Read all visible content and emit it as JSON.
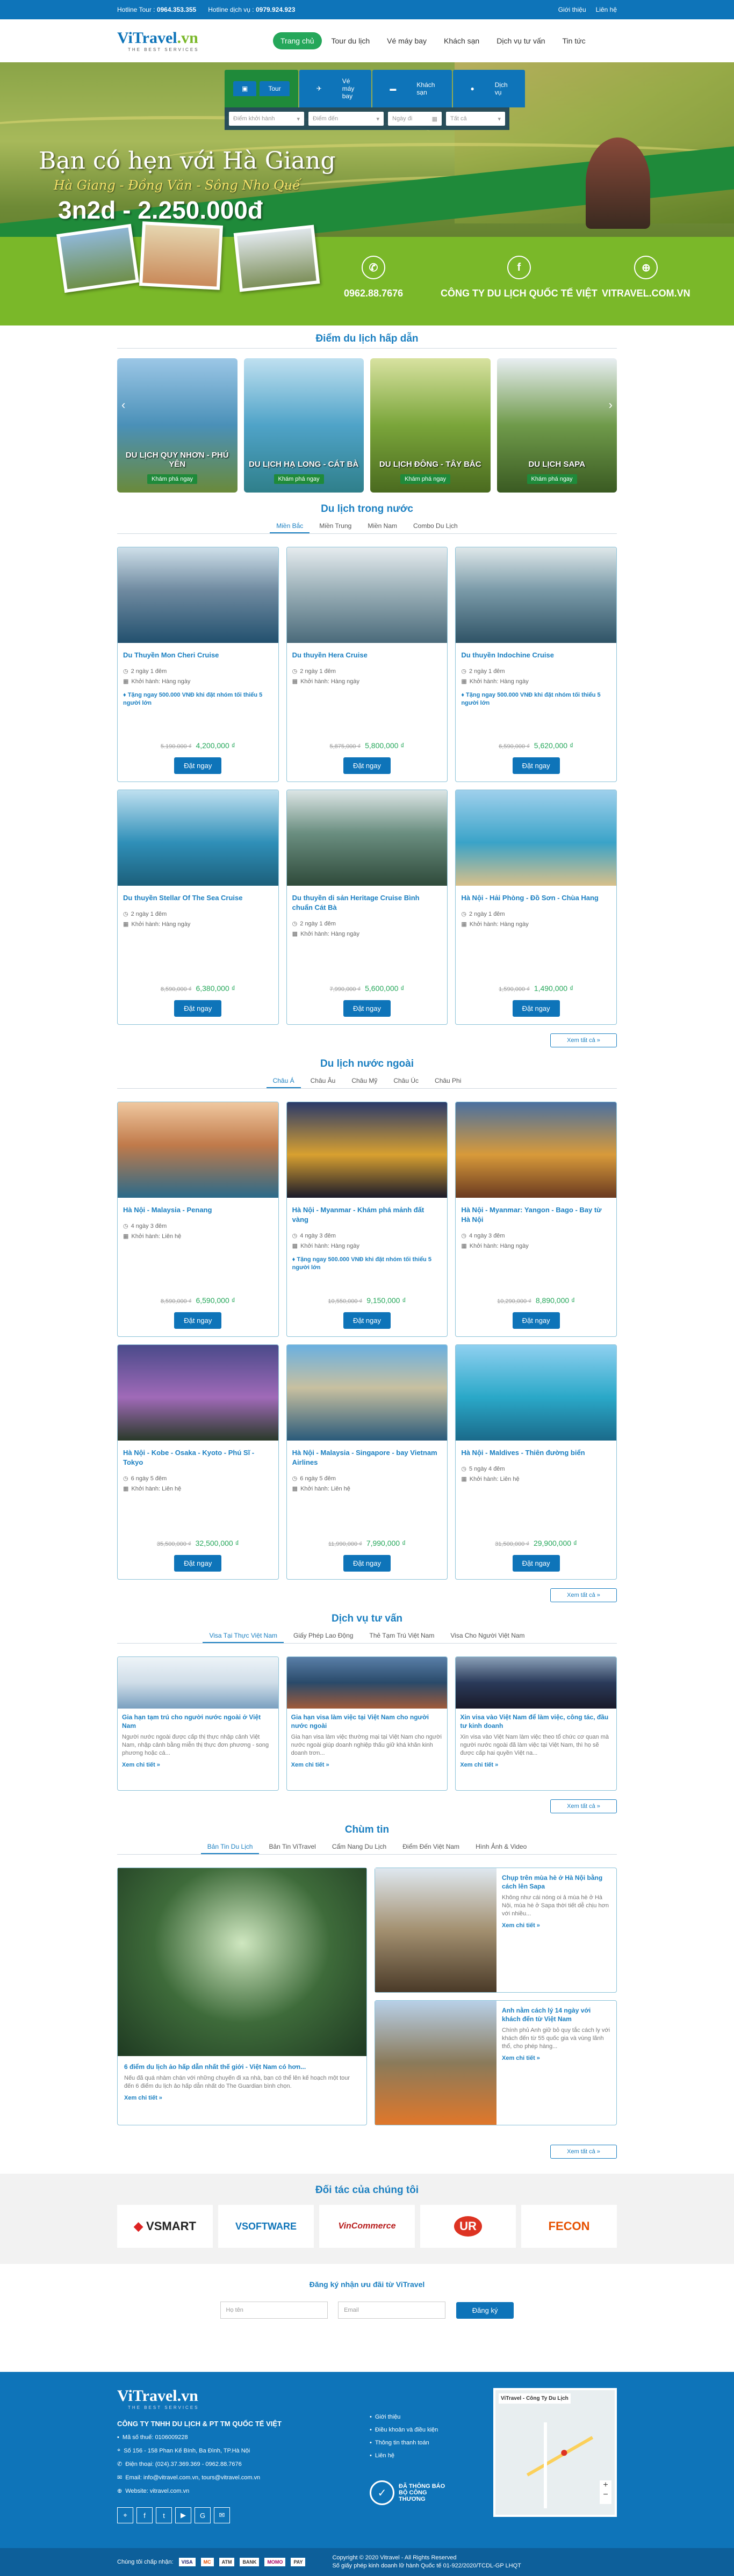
{
  "topbar": {
    "tour_label": "Hotline Tour :",
    "tour_phone": "0964.353.355",
    "service_label": "Hotline dịch vụ :",
    "service_phone": "0979.924.923",
    "links": [
      "Giới thiệu",
      "Liên hệ"
    ]
  },
  "header": {
    "logo_main": "ViTravel",
    "logo_suffix": ".vn",
    "logo_slogan": "THE BEST SERVICES",
    "nav": [
      "Trang chủ",
      "Tour du lịch",
      "Vé máy bay",
      "Khách sạn",
      "Dịch vụ tư vấn",
      "Tin tức"
    ]
  },
  "search": {
    "tabs": [
      "Tour",
      "Vé máy bay",
      "Khách sạn",
      "Dịch vụ"
    ],
    "from_placeholder": "Điểm khởi hành",
    "to_placeholder": "Điểm đến",
    "date_placeholder": "Ngày đi",
    "all_label": "Tất cả"
  },
  "hero": {
    "title": "Bạn có hẹn với Hà Giang",
    "subtitle": "Hà Giang - Đồng Văn - Sông Nho Quế",
    "price": "3n2d - 2.250.000đ",
    "phone": "0962.88.7676",
    "company": "CÔNG TY DU LỊCH QUỐC TẾ VIỆT",
    "site": "VITRAVEL.COM.VN"
  },
  "destinations": {
    "title": "Điểm du lịch hấp dẫn",
    "explore": "Khám phá ngay",
    "items": [
      "DU LỊCH QUY NHƠN - PHÚ YÊN",
      "DU LỊCH HẠ LONG - CÁT BÀ",
      "DU LỊCH ĐÔNG - TÂY BẮC",
      "DU LỊCH SAPA"
    ]
  },
  "domestic": {
    "title": "Du lịch trong nước",
    "tabs": [
      "Miền Bắc",
      "Miền Trung",
      "Miền Nam",
      "Combo Du Lịch"
    ],
    "more": "Xem tất cả »",
    "book": "Đặt ngay",
    "depart": "Khởi hành: Hàng ngày",
    "items": [
      {
        "title": "Du Thuyền Mon Cheri Cruise",
        "days": "2 ngày 1 đêm",
        "promo": "Tặng ngay 500.000 VNĐ khi đặt nhóm tối thiểu 5 người lớn",
        "old": "5.190.000 ₫",
        "price": "4,200,000 ₫"
      },
      {
        "title": "Du thuyền Hera Cruise",
        "days": "2 ngày 1 đêm",
        "promo": "",
        "old": "5,875,000 ₫",
        "price": "5,800,000 ₫"
      },
      {
        "title": "Du thuyền Indochine Cruise",
        "days": "2 ngày 1 đêm",
        "promo": "Tặng ngay 500.000 VNĐ khi đặt nhóm tối thiểu 5 người lớn",
        "old": "6,590,000 ₫",
        "price": "5,620,000 ₫"
      },
      {
        "title": "Du thuyền Stellar Of The Sea Cruise",
        "days": "2 ngày 1 đêm",
        "promo": "",
        "old": "8,590,000 ₫",
        "price": "6,380,000 ₫"
      },
      {
        "title": "Du thuyền di sản Heritage Cruise Bình chuẩn Cát Bà",
        "days": "2 ngày 1 đêm",
        "promo": "",
        "old": "7,990,000 ₫",
        "price": "5,600,000 ₫"
      },
      {
        "title": "Hà Nội - Hải Phòng - Đồ Sơn - Chùa Hang",
        "days": "2 ngày 1 đêm",
        "promo": "",
        "old": "1,590,000 ₫",
        "price": "1,490,000 ₫"
      }
    ]
  },
  "foreign": {
    "title": "Du lịch nước ngoài",
    "tabs": [
      "Châu Á",
      "Châu Âu",
      "Châu Mỹ",
      "Châu Úc",
      "Châu Phi"
    ],
    "more": "Xem tất cả »",
    "book": "Đặt ngay",
    "items": [
      {
        "title": "Hà Nội - Malaysia - Penang",
        "days": "4 ngày 3 đêm",
        "depart": "Khởi hành: Liên hệ",
        "promo": "",
        "old": "8,590,000 ₫",
        "price": "6,590,000 ₫"
      },
      {
        "title": "Hà Nội - Myanmar - Khám phá mảnh đất vàng",
        "days": "4 ngày 3 đêm",
        "depart": "Khởi hành: Hàng ngày",
        "promo": "Tặng ngay 500.000 VNĐ khi đặt nhóm tối thiểu 5 người lớn",
        "old": "10,550,000 ₫",
        "price": "9,150,000 ₫"
      },
      {
        "title": "Hà Nội - Myanmar: Yangon - Bago - Bay từ Hà Nội",
        "days": "4 ngày 3 đêm",
        "depart": "Khởi hành: Hàng ngày",
        "promo": "",
        "old": "10,290,000 ₫",
        "price": "8,890,000 ₫"
      },
      {
        "title": "Hà Nội - Kobe - Osaka - Kyoto - Phú Sĩ - Tokyo",
        "days": "6 ngày 5 đêm",
        "depart": "Khởi hành: Liên hệ",
        "promo": "",
        "old": "35,500,000 ₫",
        "price": "32,500,000 ₫"
      },
      {
        "title": "Hà Nội - Malaysia - Singapore - bay Vietnam Airlines",
        "days": "6 ngày 5 đêm",
        "depart": "Khởi hành: Liên hệ",
        "promo": "",
        "old": "11,990,000 ₫",
        "price": "7,990,000 ₫"
      },
      {
        "title": "Hà Nội - Maldives - Thiên đường biển",
        "days": "5 ngày 4 đêm",
        "depart": "Khởi hành: Liên hệ",
        "promo": "",
        "old": "31,500,000 ₫",
        "price": "29,900,000 ₫"
      }
    ]
  },
  "services": {
    "title": "Dịch vụ tư vấn",
    "tabs": [
      "Visa Tại Thực Việt Nam",
      "Giấy Phép Lao Động",
      "Thẻ Tạm Trú Việt Nam",
      "Visa Cho Người Việt Nam"
    ],
    "more": "Xem tất cả »",
    "read": "Xem chi tiết »",
    "items": [
      {
        "title": "Gia hạn tạm trú cho người nước ngoài ở Việt Nam",
        "text": "Người nước ngoài được cấp thị thực nhập cảnh Việt Nam, nhập cảnh bằng miễn thị thực đơn phương - song phương hoặc cá..."
      },
      {
        "title": "Gia hạn visa làm việc tại Việt Nam cho người nước ngoài",
        "text": "Gia hạn visa làm việc thường mại tại Việt Nam cho người nước ngoài giúp doanh nghiệp thấu giữ khá khăn kinh doanh trơn..."
      },
      {
        "title": "Xin visa vào Việt Nam để làm việc, công tác, đầu tư kinh doanh",
        "text": "Xin visa vào Việt Nam làm việc theo tổ chức cơ quan mà người nước ngoài đã làm việc tại Việt Nam, thì họ sẽ được cấp hai quyền Việt na..."
      }
    ]
  },
  "news": {
    "title": "Chùm tin",
    "tabs": [
      "Bản Tin Du Lịch",
      "Bản Tin ViTravel",
      "Cẩm Nang Du Lịch",
      "Điểm Đến Việt Nam",
      "Hình Ảnh & Video"
    ],
    "more": "Xem tất cả »",
    "read": "Xem chi tiết »",
    "main": {
      "title": "6 điểm du lịch ảo hấp dẫn nhất thế giới - Việt Nam có hơn...",
      "text": "Nếu đã quá nhàm chán với những chuyến đi xa nhà, bạn có thể lên kế hoạch một tour đến 6 điểm du lịch ảo hấp dẫn nhất do The Guardian bình chọn."
    },
    "side": [
      {
        "title": "Chụp trên mùa hè ở Hà Nội bằng cách lên Sapa",
        "text": "Không như cái nóng oi ả mùa hè ở Hà Nội, mùa hè ở Sapa thời tiết dễ chịu hơn với nhiều..."
      },
      {
        "title": "Anh nằm cách lý 14 ngày với khách đến từ Việt Nam",
        "text": "Chính phủ Anh giữ bỏ quy tắc cách ly với khách đến từ 55 quốc gia và vùng lãnh thổ, cho phép hàng..."
      }
    ]
  },
  "partners": {
    "title": "Đối tác của chúng tôi",
    "items": [
      "VSMART",
      "VSOFTWARE",
      "VinCommerce",
      "UR",
      "FECON"
    ]
  },
  "subscribe": {
    "title": "Đăng ký nhận ưu đãi từ ViTravel",
    "name_ph": "Họ tên",
    "email_ph": "Email",
    "button": "Đăng ký"
  },
  "footer": {
    "company": "CÔNG TY TNHH DU LỊCH & PT TM QUỐC TẾ VIỆT",
    "tax": "Mã số thuế: 0106009228",
    "address": "Số 156 - 158 Phan Kế Bính, Ba Đình, TP.Hà Nội",
    "phone": "Điện thoại: (024).37.369.369 - 0962.88.7676",
    "email": "Email: info@vitravel.com.vn, tours@vitravel.com.vn",
    "website": "Website: vitravel.com.vn",
    "links": [
      "Giới thiệu",
      "Điều khoản và điều kiện",
      "Thông tin thanh toán",
      "Liên hệ"
    ],
    "badge": "ĐÃ THÔNG BÁO BỘ CÔNG THƯƠNG",
    "map_label": "ViTravel - Công Ty Du Lịch",
    "payment_label": "Chúng tôi chấp nhận:",
    "payments": [
      "VISA",
      "MC",
      "ATM",
      "BANK",
      "MOMO",
      "PAY"
    ],
    "copyright": "Copyright © 2020 Vitravel - All Rights Reserved",
    "license": "Số giấy phép kinh doanh lữ hành Quốc tế 01-922/2020/TCDL-GP LHQT"
  }
}
